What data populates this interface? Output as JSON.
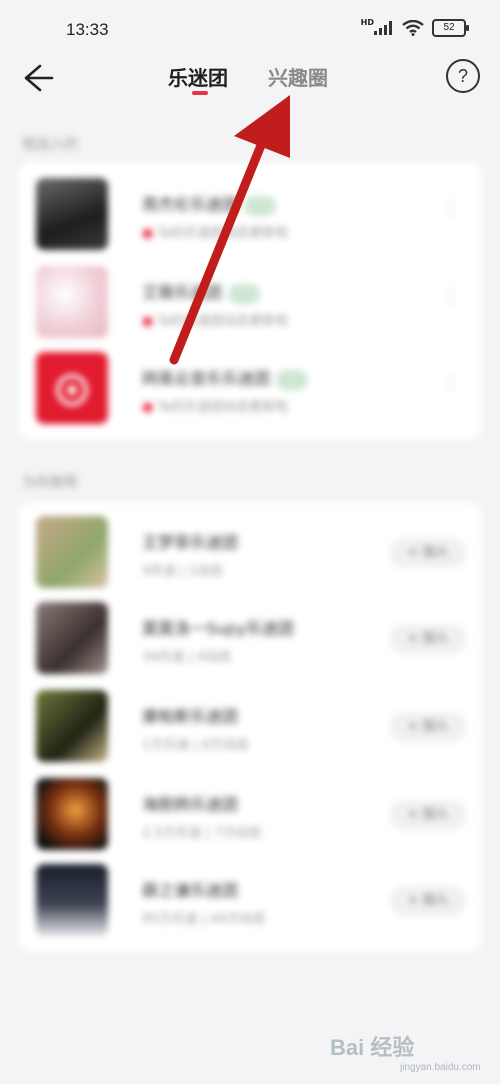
{
  "status_bar": {
    "time": "13:33",
    "network_badge": "HD",
    "battery_level": "52"
  },
  "nav": {
    "tabs": [
      {
        "label": "乐迷团",
        "active": true
      },
      {
        "label": "兴趣圈",
        "active": false
      }
    ],
    "help_label": "?"
  },
  "joined": {
    "title": "我加入的",
    "items": [
      {
        "name": "周杰伦乐迷团",
        "sub": "Ta的乐迷团动态更新啦",
        "avatar_color": "#2b2b2b"
      },
      {
        "name": "艾薇乐迷团",
        "sub": "Ta的乐迷团动态更新啦",
        "avatar_color": "#f2d4dc"
      },
      {
        "name": "网易云音乐乐迷团",
        "sub": "Ta的乐迷团动态更新啦",
        "avatar_color": "#e21b30"
      }
    ]
  },
  "recommended": {
    "title": "为你推荐",
    "join_label": "+ 加入",
    "items": [
      {
        "name": "王梦菲乐迷团",
        "sub": "4乐迷 | 1动态",
        "avatar_color": "#9aa88a"
      },
      {
        "name": "莫莫洛一Supy乐迷团",
        "sub": "34乐迷 | 4动态",
        "avatar_color": "#6a5c58"
      },
      {
        "name": "康帕斯乐迷团",
        "sub": "1万乐迷 | 6万动态",
        "avatar_color": "#4a5a34"
      },
      {
        "name": "海胆鸦乐迷团",
        "sub": "2.5万乐迷 | 7万动态",
        "avatar_color": "#5a2a12"
      },
      {
        "name": "薛之谦乐迷团",
        "sub": "95万乐迷 | 44万动态",
        "avatar_color": "#3c4150"
      }
    ]
  },
  "annotation": {
    "arrow_color": "#c21d1d"
  },
  "watermark": {
    "text": "Bai 经验",
    "sub": "jingyan.baidu.com"
  }
}
